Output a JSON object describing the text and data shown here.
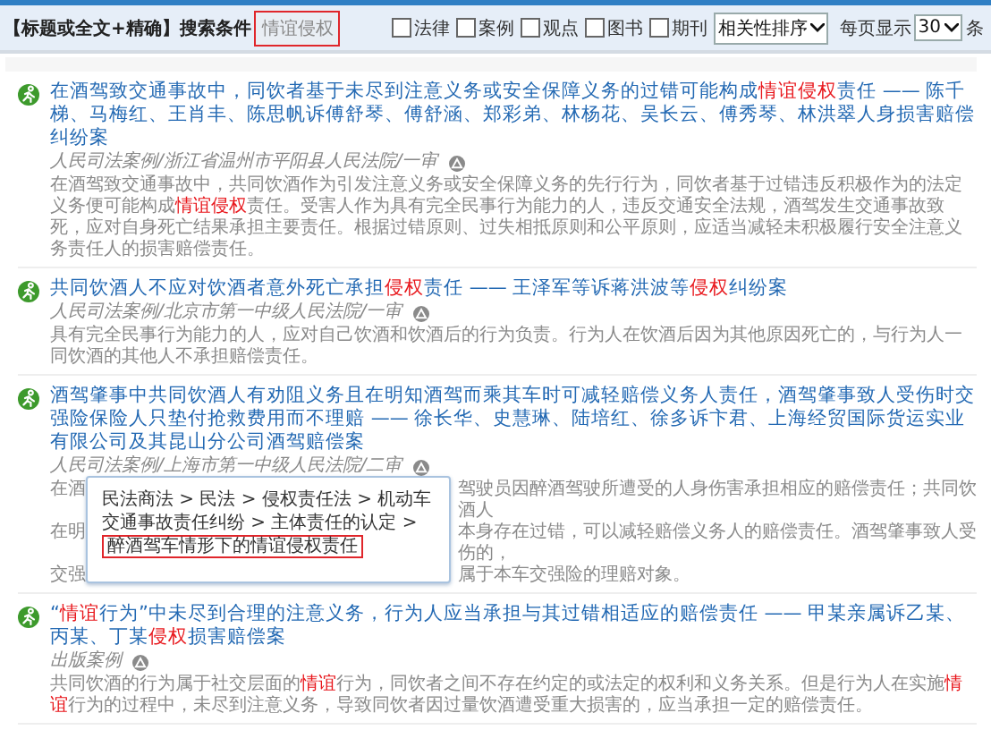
{
  "search_bar": {
    "scope_label": "【标题或全文+精确】搜索条件",
    "query": "情谊侵权",
    "filters": [
      {
        "label": "法律",
        "checked": false
      },
      {
        "label": "案例",
        "checked": false
      },
      {
        "label": "观点",
        "checked": false
      },
      {
        "label": "图书",
        "checked": false
      },
      {
        "label": "期刊",
        "checked": false
      }
    ],
    "sort": "相关性排序",
    "per_page_label": "每页显示",
    "per_page": "30",
    "per_page_unit": "条"
  },
  "results": [
    {
      "kind": "full",
      "title": "在酒驾致交通事故中，同饮者基于未尽到注意义务或安全保障义务的过错可能构成**情谊侵权**责任 —— 陈千梯、马梅红、王肖丰、陈思帆诉傅舒琴、傅舒涵、郑彩弟、林杨花、吴长云、傅秀琴、林洪翠人身损害赔偿纠纷案",
      "source": "人民司法案例/浙江省温州市平阳县人民法院/一审",
      "summary": "在酒驾致交通事故中，共同饮酒作为引发注意义务或安全保障义务的先行行为，同饮者基于过错违反积极作为的法定义务便可能构成**情谊侵权**责任。受害人作为具有完全民事行为能力的人，违反交通安全法规，酒驾发生交通事故致死，应对自身死亡结果承担主要责任。根据过错原则、过失相抵原则和公平原则，应适当减轻未积极履行安全注意义务责任人的损害赔偿责任。"
    },
    {
      "kind": "full",
      "title": "共同饮酒人不应对饮酒者意外死亡承担**侵权**责任 —— 王泽军等诉蒋洪波等**侵权**纠纷案",
      "source": "人民司法案例/北京市第一中级人民法院/一审",
      "summary": "具有完全民事行为能力的人，应对自己饮酒和饮酒后的行为负责。行为人在饮酒后因为其他原因死亡的，与行为人一同饮酒的其他人不承担赔偿责任。"
    },
    {
      "kind": "covered",
      "title": "酒驾肇事中共同饮酒人有劝阻义务且在明知酒驾而乘其车时可减轻赔偿义务人责任，酒驾肇事致人受伤时交强险保险人只垫付抢救费用而不理赔 —— 徐长华、史慧琳、陆培红、徐多诉卞君、上海经贸国际货运实业有限公司及其昆山分公司酒驾赔偿案",
      "source": "人民司法案例/上海市第一中级人民法院/二审",
      "fragments": [
        {
          "left": "在酒",
          "right": "驾驶员因醉酒驾驶所遭受的人身伤害承担相应的赔偿责任；共同饮酒人"
        },
        {
          "left": "在明",
          "right": "本身存在过错，可以减轻赔偿义务人的赔偿责任。酒驾肇事致人受伤的，"
        },
        {
          "left": "交强",
          "right": "属于本车交强险的理赔对象。"
        }
      ],
      "popup": {
        "path": "民法商法 > 民法 > 侵权责任法 > 机动车交通事故责任纠纷 > 主体责任的认定 >",
        "current": "醉酒驾车情形下的情谊侵权责任"
      }
    },
    {
      "kind": "full",
      "title": "“**情谊**行为”中未尽到合理的注意义务，行为人应当承担与其过错相适应的赔偿责任 —— 甲某亲属诉乙某、丙某、丁某**侵权**损害赔偿案",
      "source": "出版案例",
      "summary": "共同饮酒的行为属于社交层面的**情谊**行为，同饮者之间不存在约定的或法定的权利和义务关系。但是行为人在实施**情谊**行为的过程中，未尽到注意义务，导致同饮者因过量饮酒遭受重大损害的，应当承担一定的赔偿责任。"
    }
  ]
}
